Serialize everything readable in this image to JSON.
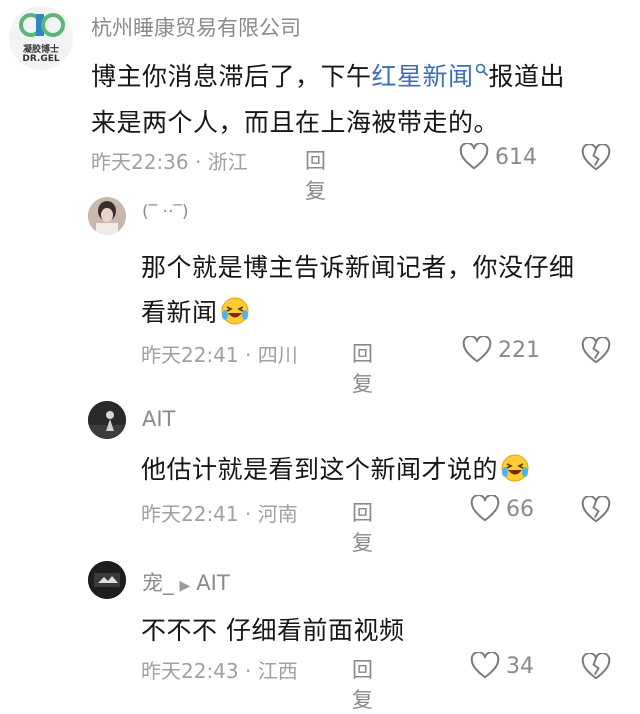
{
  "colors": {
    "link": "#3b6fb6",
    "text": "#161616",
    "meta": "#a0a0a0",
    "brand_green": "#5bb67b",
    "brand_blue": "#2f86c7"
  },
  "comments": [
    {
      "username": "杭州睡康贸易有限公司",
      "avatar": {
        "icon": "dr-gel-logo",
        "logo_text": "凝胶博士",
        "logo_sub": "DR.GEL"
      },
      "line1_a": "博主你消息滞后了，下午",
      "line1_link": "红星新闻",
      "line1_b": "报道出",
      "line2": "来是两个人，而且在上海被带走的。",
      "time": "昨天22:36",
      "location": "浙江",
      "reply_label": "回复",
      "likes": "614"
    },
    {
      "username": "(‾ ··‾)",
      "avatar": {
        "icon": "photo-avatar"
      },
      "line1": "那个就是博主告诉新闻记者，你没仔细",
      "line2": "看新闻",
      "emoji": "laughing-tears-emoji",
      "time": "昨天22:41",
      "location": "四川",
      "reply_label": "回复",
      "likes": "221"
    },
    {
      "username": "AIT",
      "avatar": {
        "icon": "dark-photo-avatar"
      },
      "line1": "他估计就是看到这个新闻才说的",
      "emoji": "laughing-tears-emoji",
      "time": "昨天22:41",
      "location": "河南",
      "reply_label": "回复",
      "likes": "66"
    },
    {
      "username": "宠_",
      "reply_to": "AIT",
      "avatar": {
        "icon": "dark-photo-avatar"
      },
      "line1": "不不不 仔细看前面视频",
      "time": "昨天22:43",
      "location": "江西",
      "reply_label": "回复",
      "likes": "34"
    }
  ]
}
